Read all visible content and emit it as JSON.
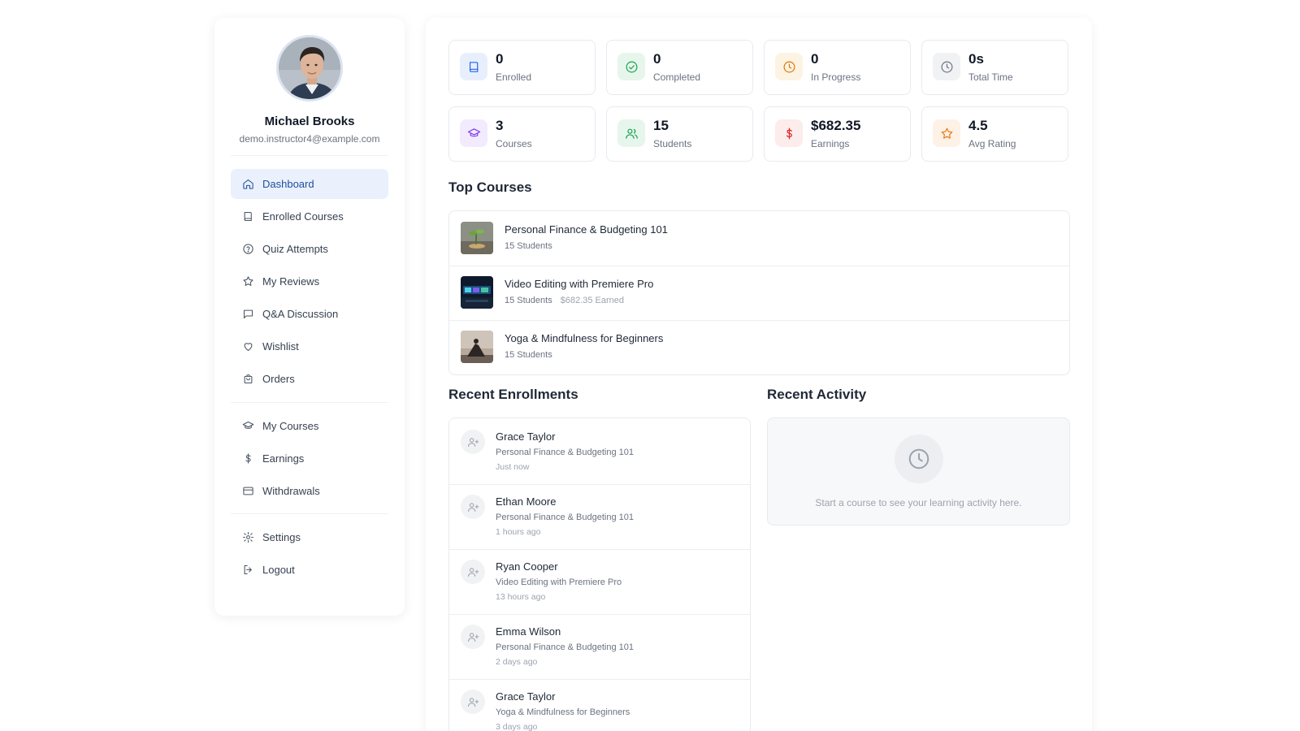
{
  "profile": {
    "name": "Michael Brooks",
    "email": "demo.instructor4@example.com"
  },
  "nav": {
    "primary": [
      {
        "label": "Dashboard",
        "icon": "home-icon",
        "active": true
      },
      {
        "label": "Enrolled Courses",
        "icon": "book-icon"
      },
      {
        "label": "Quiz Attempts",
        "icon": "help-circle-icon"
      },
      {
        "label": "My Reviews",
        "icon": "star-icon"
      },
      {
        "label": "Q&A Discussion",
        "icon": "message-square-icon"
      },
      {
        "label": "Wishlist",
        "icon": "heart-icon"
      },
      {
        "label": "Orders",
        "icon": "shopping-bag-icon"
      }
    ],
    "instructor": [
      {
        "label": "My Courses",
        "icon": "graduation-cap-icon"
      },
      {
        "label": "Earnings",
        "icon": "dollar-icon"
      },
      {
        "label": "Withdrawals",
        "icon": "credit-card-icon"
      }
    ],
    "account": [
      {
        "label": "Settings",
        "icon": "gear-icon"
      },
      {
        "label": "Logout",
        "icon": "logout-icon"
      }
    ]
  },
  "stats": [
    {
      "value": "0",
      "label": "Enrolled",
      "icon": "book-icon",
      "color": "#2563eb",
      "bg": "#e8effc"
    },
    {
      "value": "0",
      "label": "Completed",
      "icon": "check-circle-icon",
      "color": "#16a34a",
      "bg": "#e7f6ec"
    },
    {
      "value": "0",
      "label": "In Progress",
      "icon": "clock-icon",
      "color": "#d97706",
      "bg": "#fdf3e3"
    },
    {
      "value": "0s",
      "label": "Total Time",
      "icon": "clock-icon",
      "color": "#6b7280",
      "bg": "#f1f2f4"
    },
    {
      "value": "3",
      "label": "Courses",
      "icon": "graduation-cap-icon",
      "color": "#7c3aed",
      "bg": "#f1ebfd"
    },
    {
      "value": "15",
      "label": "Students",
      "icon": "users-icon",
      "color": "#16a34a",
      "bg": "#e7f6ec"
    },
    {
      "value": "$682.35",
      "label": "Earnings",
      "icon": "dollar-icon",
      "color": "#dc2626",
      "bg": "#fdecec"
    },
    {
      "value": "4.5",
      "label": "Avg Rating",
      "icon": "star-icon",
      "color": "#ea7a1a",
      "bg": "#fef1e5"
    }
  ],
  "top_courses": {
    "title": "Top Courses",
    "items": [
      {
        "title": "Personal Finance & Budgeting 101",
        "students": "15 Students",
        "earned": ""
      },
      {
        "title": "Video Editing with Premiere Pro",
        "students": "15 Students",
        "earned": "$682.35 Earned"
      },
      {
        "title": "Yoga & Mindfulness for Beginners",
        "students": "15 Students",
        "earned": ""
      }
    ]
  },
  "recent_enrollments": {
    "title": "Recent Enrollments",
    "items": [
      {
        "name": "Grace Taylor",
        "course": "Personal Finance & Budgeting 101",
        "time": "Just now"
      },
      {
        "name": "Ethan Moore",
        "course": "Personal Finance & Budgeting 101",
        "time": "1 hours ago"
      },
      {
        "name": "Ryan Cooper",
        "course": "Video Editing with Premiere Pro",
        "time": "13 hours ago"
      },
      {
        "name": "Emma Wilson",
        "course": "Personal Finance & Budgeting 101",
        "time": "2 days ago"
      },
      {
        "name": "Grace Taylor",
        "course": "Yoga & Mindfulness for Beginners",
        "time": "3 days ago"
      }
    ]
  },
  "recent_activity": {
    "title": "Recent Activity",
    "empty_text": "Start a course to see your learning activity here."
  }
}
